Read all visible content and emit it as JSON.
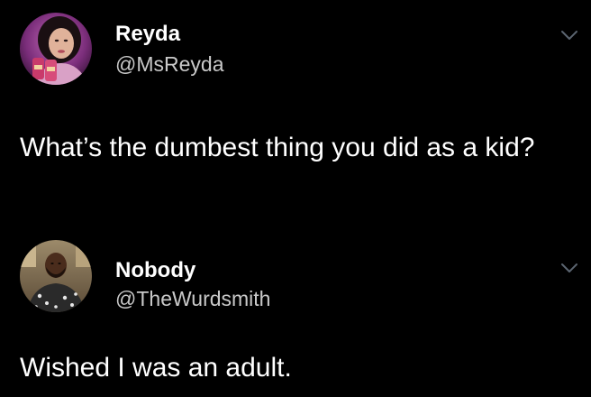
{
  "tweets": [
    {
      "display_name": "Reyda",
      "handle": "@MsReyda",
      "text": "What’s the dumbest thing you did as a kid?",
      "avatar_icon": "profile-photo-reyda",
      "menu_icon": "chevron-down-icon"
    },
    {
      "display_name": "Nobody",
      "handle": "@TheWurdsmith",
      "text": "Wished I was an adult.",
      "avatar_icon": "profile-photo-nobody",
      "menu_icon": "chevron-down-icon"
    }
  ],
  "colors": {
    "background": "#000000",
    "primary_text": "#ffffff",
    "secondary_text": "#c9c9c9",
    "chevron": "#5b6570"
  }
}
